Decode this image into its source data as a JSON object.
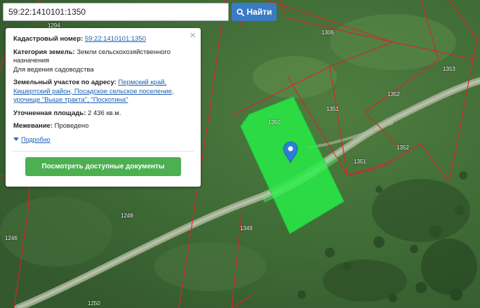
{
  "search": {
    "value": "59:22:1410101:1350",
    "button_label": "Найти"
  },
  "popup": {
    "cadastral_label": "Кадастровый номер:",
    "cadastral_value": "59:22:1410101:1350",
    "category_label": "Категория земель:",
    "category_value": "Земли сельскохозяйственного назначения",
    "use_value": "Для ведения садоводства",
    "address_label": "Земельный участок по адресу:",
    "address_value": "Пермский край, Кишертский район, Посадское сельское поселение, урочище \"Выше тракта\", \"Поскотина\"",
    "area_label": "Уточненная площадь:",
    "area_value": "2 436 кв.м.",
    "survey_label": "Межевание:",
    "survey_value": "Проведено",
    "more_label": "Подробно",
    "docs_button": "Посмотреть доступные документы",
    "close_symbol": "×"
  },
  "map": {
    "parcel_labels": [
      {
        "id": "1294",
        "text": "1294"
      },
      {
        "id": "1306",
        "text": "1306"
      },
      {
        "id": "1353",
        "text": "1353"
      },
      {
        "id": "1352a",
        "text": "1352"
      },
      {
        "id": "1351a",
        "text": "1351"
      },
      {
        "id": "1350",
        "text": "1350"
      },
      {
        "id": "1352b",
        "text": "1352"
      },
      {
        "id": "1351b",
        "text": "1351"
      },
      {
        "id": "1249",
        "text": "1249"
      },
      {
        "id": "1349",
        "text": "1349"
      },
      {
        "id": "1246",
        "text": "1246"
      },
      {
        "id": "1250",
        "text": "1250"
      }
    ],
    "selected_parcel_color": "#28e846",
    "boundary_color": "#e0202a",
    "marker_color": "#2d7fd6"
  }
}
